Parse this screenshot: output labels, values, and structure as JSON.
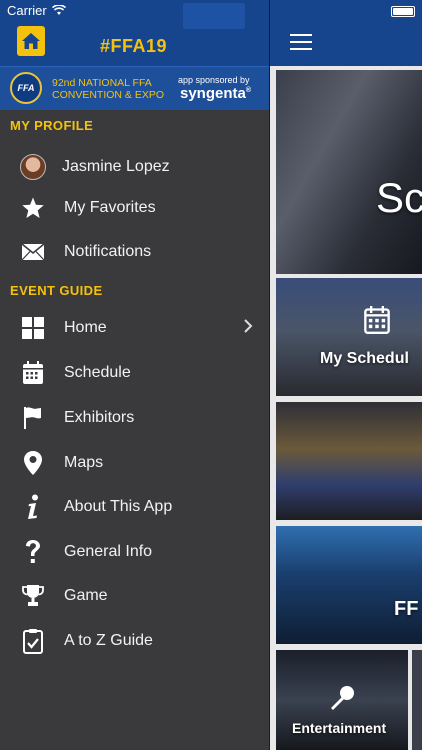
{
  "status": {
    "carrier": "Carrier"
  },
  "header": {
    "title": "#FFA19"
  },
  "banner": {
    "convention_line1": "92nd NATIONAL FFA",
    "convention_line2": "CONVENTION & EXPO",
    "sponsor_line": "app sponsored by",
    "sponsor_name": "syngenta",
    "logo_text": "FFA"
  },
  "profile": {
    "heading": "MY PROFILE",
    "items": [
      {
        "label": "Jasmine Lopez",
        "icon": "avatar"
      },
      {
        "label": "My Favorites",
        "icon": "star-icon"
      },
      {
        "label": "Notifications",
        "icon": "envelope-icon"
      }
    ]
  },
  "guide": {
    "heading": "EVENT GUIDE",
    "items": [
      {
        "label": "Home",
        "icon": "grid-icon"
      },
      {
        "label": "Schedule",
        "icon": "calendar-icon"
      },
      {
        "label": "Exhibitors",
        "icon": "flag-icon"
      },
      {
        "label": "Maps",
        "icon": "map-pin-icon"
      },
      {
        "label": "About This App",
        "icon": "info-icon"
      },
      {
        "label": "General Info",
        "icon": "question-icon"
      },
      {
        "label": "Game",
        "icon": "trophy-icon"
      },
      {
        "label": "A to Z Guide",
        "icon": "clipboard-icon"
      }
    ]
  },
  "content": {
    "hero_text": "Sc",
    "schedule_text": "My Schedul",
    "ffa_text": "FF",
    "entertainment_text": "Entertainment"
  },
  "colors": {
    "header_blue": "#16458e",
    "accent_yellow": "#f4c20d",
    "drawer_bg": "#3a3a3c"
  }
}
